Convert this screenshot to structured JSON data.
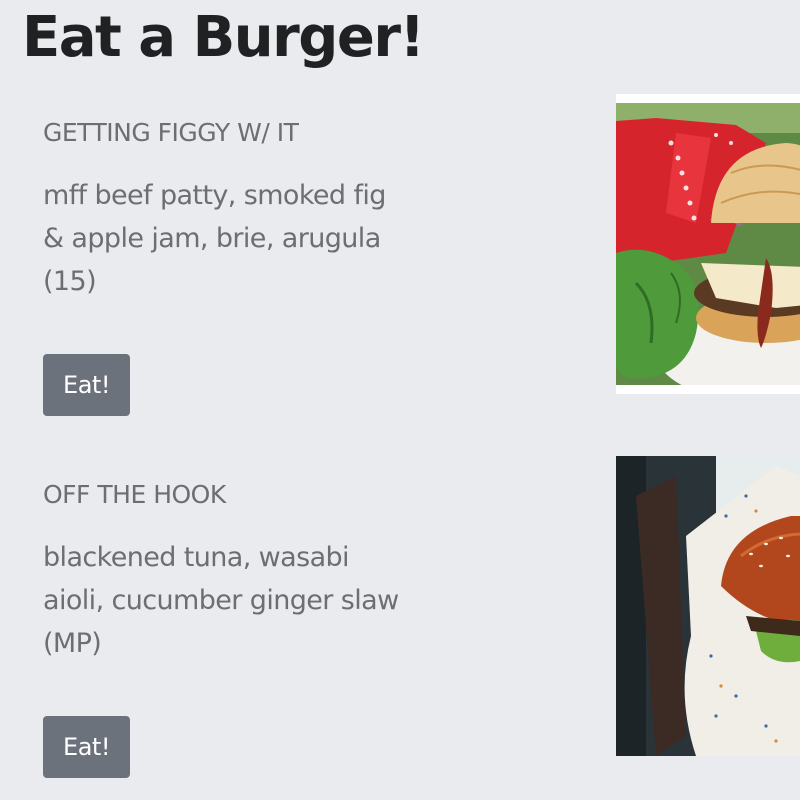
{
  "page": {
    "title": "Eat a Burger!"
  },
  "menu": {
    "items": [
      {
        "name": "GETTING FIGGY W/ IT",
        "description": "mff beef patty, smoked fig & apple jam, brie, arugula (15)",
        "button_label": "Eat!",
        "photo_icon": "burger-photo-figgy"
      },
      {
        "name": "OFF THE HOOK",
        "description": "blackened tuna, wasabi aioli, cucumber ginger slaw (MP)",
        "button_label": "Eat!",
        "photo_icon": "burger-photo-tuna"
      }
    ]
  },
  "colors": {
    "background": "#e9ebee",
    "title": "#1f2123",
    "text_muted": "#6c6e71",
    "button": "#6c727b",
    "button_text": "#ffffff"
  }
}
